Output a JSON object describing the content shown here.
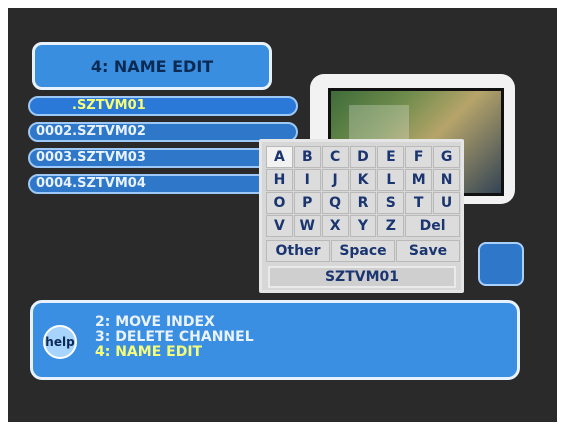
{
  "title": "4: NAME  EDIT",
  "channels": [
    {
      "label": ".SZTVM01"
    },
    {
      "label": "0002.SZTVM02"
    },
    {
      "label": "0003.SZTVM03"
    },
    {
      "label": "0004.SZTVM04"
    }
  ],
  "keyboard": {
    "letters": [
      "A",
      "B",
      "C",
      "D",
      "E",
      "F",
      "G",
      "H",
      "I",
      "J",
      "K",
      "L",
      "M",
      "N",
      "O",
      "P",
      "Q",
      "R",
      "S",
      "T",
      "U",
      "V",
      "W",
      "X",
      "Y",
      "Z"
    ],
    "del_label": "Del",
    "other_label": "Other",
    "space_label": "Space",
    "save_label": "Save",
    "current_name": "SZTVM01"
  },
  "help": {
    "icon_label": "help",
    "lines": [
      {
        "text": "2:  MOVE  INDEX"
      },
      {
        "text": "3:  DELETE  CHANNEL"
      },
      {
        "text": "4:  NAME  EDIT"
      }
    ]
  },
  "colors": {
    "panel_blue": "#3b8fe2",
    "highlight_yellow": "#f6ff7a",
    "key_text": "#1a356f"
  }
}
